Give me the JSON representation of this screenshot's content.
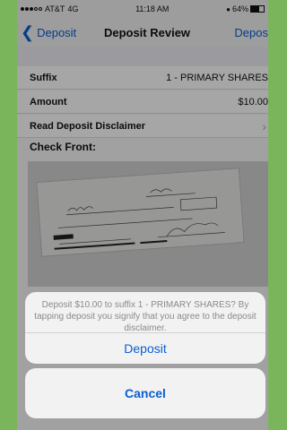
{
  "status": {
    "carrier": "AT&T",
    "network": "4G",
    "time": "11:18 AM",
    "battery": "64%"
  },
  "nav": {
    "back_label": "Deposit",
    "title": "Deposit Review",
    "right_label": "Depos"
  },
  "rows": [
    {
      "label": "Suffix",
      "value": "1 - PRIMARY SHARES"
    },
    {
      "label": "Amount",
      "value": "$10.00"
    },
    {
      "label": "Read Deposit Disclaimer",
      "value": ""
    }
  ],
  "check": {
    "header": "Check Front:"
  },
  "alert": {
    "message": "Deposit $10.00 to suffix 1 - PRIMARY SHARES? By tapping deposit you signify that you agree to the deposit disclaimer.",
    "deposit_label": "Deposit",
    "cancel_label": "Cancel"
  },
  "colors": {
    "accent": "#0a5fd1",
    "frame": "#7ab55c"
  }
}
